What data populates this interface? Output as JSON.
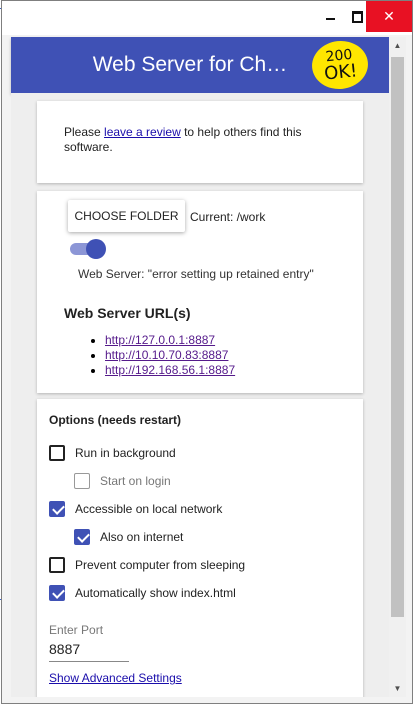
{
  "window": {
    "minimize_icon": "minimize-icon",
    "maximize_icon": "maximize-icon",
    "close_icon": "close-icon",
    "close_symbol": "✕"
  },
  "header": {
    "title": "Web Server for Ch…",
    "badge_line1": "200",
    "badge_line2": "OK!",
    "bg_color": "#3f51b5",
    "badge_color": "#ffe600"
  },
  "review": {
    "prefix": "Please ",
    "link": "leave a review",
    "suffix": " to help others find this software."
  },
  "server": {
    "choose_folder_label": "CHOOSE FOLDER",
    "current_folder": "Current: /work",
    "toggle_on": true,
    "status": "Web Server: \"error setting up retained entry\"",
    "urls_heading": "Web Server URL(s)",
    "urls": [
      "http://127.0.0.1:8887",
      "http://10.10.70.83:8887",
      "http://192.168.56.1:8887"
    ]
  },
  "options": {
    "heading": "Options (needs restart)",
    "items": [
      {
        "label": "Run in background",
        "checked": false
      },
      {
        "label": "Start on login",
        "checked": false,
        "disabled": true
      },
      {
        "label": "Accessible on local network",
        "checked": true
      },
      {
        "label": "Also on internet",
        "checked": true
      },
      {
        "label": "Prevent computer from sleeping",
        "checked": false
      },
      {
        "label": "Automatically show index.html",
        "checked": true
      }
    ],
    "port_label": "Enter Port",
    "port_value": "8887",
    "advanced_link": "Show Advanced Settings"
  },
  "scrollbar": {
    "up_symbol": "▲",
    "down_symbol": "▼"
  }
}
